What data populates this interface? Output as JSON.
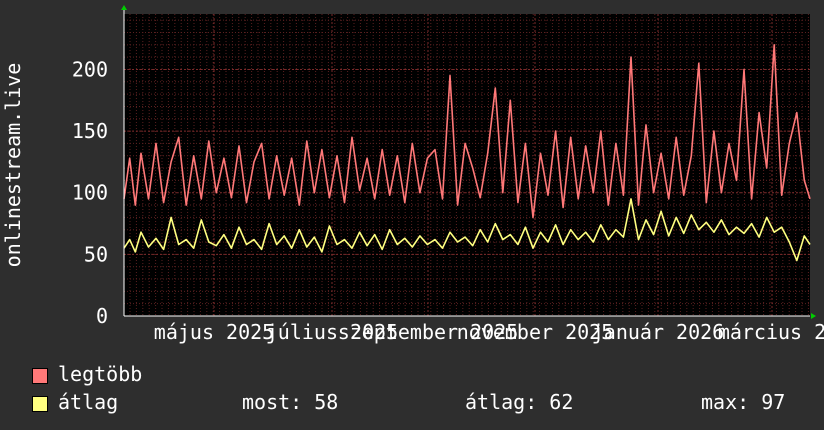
{
  "colors": {
    "background": "#2e2e2e",
    "plot_background": "#000000",
    "grid_minor": "#5a2020",
    "grid_major": "#7a2a2a",
    "axis": "#ffffff",
    "arrow": "#00cc00",
    "series_max": "#ff7878",
    "series_avg": "#ffff80"
  },
  "legend": {
    "max_label": "legtöbb",
    "avg_label": "átlag",
    "now_text": "most: 58",
    "avg_text": "átlag: 62",
    "max_text": "max: 97"
  },
  "chart_data": {
    "type": "line",
    "ylabel": "onlinestream.live",
    "ylim": [
      0,
      245
    ],
    "yticks": [
      0,
      50,
      100,
      150,
      200
    ],
    "xticks": [
      "május 2025",
      "július 2025",
      "szeptember 2025",
      "november 2025",
      "január 2026",
      "március 2"
    ],
    "x_range": [
      "2025-04-01",
      "2026-03-31"
    ],
    "grid": true,
    "series": [
      {
        "name": "legtöbb",
        "color": "#ff7878",
        "x": [
          "2025-04-01",
          "2025-04-04",
          "2025-04-07",
          "2025-04-10",
          "2025-04-14",
          "2025-04-18",
          "2025-04-22",
          "2025-04-26",
          "2025-04-30",
          "2025-05-04",
          "2025-05-08",
          "2025-05-12",
          "2025-05-16",
          "2025-05-20",
          "2025-05-24",
          "2025-05-28",
          "2025-06-01",
          "2025-06-05",
          "2025-06-09",
          "2025-06-13",
          "2025-06-17",
          "2025-06-21",
          "2025-06-25",
          "2025-06-29",
          "2025-07-03",
          "2025-07-07",
          "2025-07-11",
          "2025-07-15",
          "2025-07-19",
          "2025-07-23",
          "2025-07-27",
          "2025-07-31",
          "2025-08-04",
          "2025-08-08",
          "2025-08-12",
          "2025-08-16",
          "2025-08-20",
          "2025-08-24",
          "2025-08-28",
          "2025-09-01",
          "2025-09-05",
          "2025-09-09",
          "2025-09-13",
          "2025-09-17",
          "2025-09-21",
          "2025-09-25",
          "2025-09-29",
          "2025-10-03",
          "2025-10-07",
          "2025-10-11",
          "2025-10-15",
          "2025-10-19",
          "2025-10-23",
          "2025-10-27",
          "2025-10-31",
          "2025-11-04",
          "2025-11-08",
          "2025-11-12",
          "2025-11-16",
          "2025-11-20",
          "2025-11-24",
          "2025-11-28",
          "2025-12-02",
          "2025-12-06",
          "2025-12-10",
          "2025-12-14",
          "2025-12-18",
          "2025-12-22",
          "2025-12-26",
          "2025-12-30",
          "2026-01-03",
          "2026-01-07",
          "2026-01-11",
          "2026-01-15",
          "2026-01-19",
          "2026-01-23",
          "2026-01-27",
          "2026-01-31",
          "2026-02-04",
          "2026-02-08",
          "2026-02-12",
          "2026-02-16",
          "2026-02-20",
          "2026-02-24",
          "2026-02-28",
          "2026-03-04",
          "2026-03-08",
          "2026-03-12",
          "2026-03-16",
          "2026-03-20",
          "2026-03-24",
          "2026-03-28",
          "2026-03-31"
        ],
        "values": [
          95,
          128,
          90,
          132,
          95,
          140,
          92,
          125,
          145,
          90,
          130,
          95,
          142,
          100,
          128,
          96,
          138,
          92,
          125,
          140,
          95,
          130,
          98,
          128,
          90,
          142,
          100,
          135,
          96,
          130,
          92,
          145,
          102,
          128,
          95,
          135,
          98,
          130,
          92,
          140,
          100,
          128,
          135,
          95,
          195,
          90,
          140,
          120,
          96,
          132,
          185,
          100,
          175,
          92,
          140,
          80,
          132,
          98,
          150,
          88,
          145,
          95,
          138,
          100,
          150,
          90,
          140,
          98,
          210,
          90,
          155,
          100,
          132,
          95,
          145,
          98,
          130,
          205,
          92,
          150,
          100,
          140,
          110,
          200,
          95,
          165,
          120,
          220,
          98,
          140,
          165,
          110,
          95
        ]
      },
      {
        "name": "átlag",
        "color": "#ffff80",
        "x": [
          "2025-04-01",
          "2025-04-04",
          "2025-04-07",
          "2025-04-10",
          "2025-04-14",
          "2025-04-18",
          "2025-04-22",
          "2025-04-26",
          "2025-04-30",
          "2025-05-04",
          "2025-05-08",
          "2025-05-12",
          "2025-05-16",
          "2025-05-20",
          "2025-05-24",
          "2025-05-28",
          "2025-06-01",
          "2025-06-05",
          "2025-06-09",
          "2025-06-13",
          "2025-06-17",
          "2025-06-21",
          "2025-06-25",
          "2025-06-29",
          "2025-07-03",
          "2025-07-07",
          "2025-07-11",
          "2025-07-15",
          "2025-07-19",
          "2025-07-23",
          "2025-07-27",
          "2025-07-31",
          "2025-08-04",
          "2025-08-08",
          "2025-08-12",
          "2025-08-16",
          "2025-08-20",
          "2025-08-24",
          "2025-08-28",
          "2025-09-01",
          "2025-09-05",
          "2025-09-09",
          "2025-09-13",
          "2025-09-17",
          "2025-09-21",
          "2025-09-25",
          "2025-09-29",
          "2025-10-03",
          "2025-10-07",
          "2025-10-11",
          "2025-10-15",
          "2025-10-19",
          "2025-10-23",
          "2025-10-27",
          "2025-10-31",
          "2025-11-04",
          "2025-11-08",
          "2025-11-12",
          "2025-11-16",
          "2025-11-20",
          "2025-11-24",
          "2025-11-28",
          "2025-12-02",
          "2025-12-06",
          "2025-12-10",
          "2025-12-14",
          "2025-12-18",
          "2025-12-22",
          "2025-12-26",
          "2025-12-30",
          "2026-01-03",
          "2026-01-07",
          "2026-01-11",
          "2026-01-15",
          "2026-01-19",
          "2026-01-23",
          "2026-01-27",
          "2026-01-31",
          "2026-02-04",
          "2026-02-08",
          "2026-02-12",
          "2026-02-16",
          "2026-02-20",
          "2026-02-24",
          "2026-02-28",
          "2026-03-04",
          "2026-03-08",
          "2026-03-12",
          "2026-03-16",
          "2026-03-20",
          "2026-03-24",
          "2026-03-28",
          "2026-03-31"
        ],
        "values": [
          55,
          62,
          52,
          68,
          56,
          63,
          54,
          80,
          58,
          62,
          55,
          78,
          60,
          57,
          66,
          55,
          72,
          58,
          62,
          54,
          75,
          58,
          65,
          55,
          70,
          56,
          64,
          52,
          73,
          58,
          62,
          55,
          68,
          57,
          66,
          54,
          70,
          58,
          63,
          56,
          65,
          58,
          62,
          55,
          68,
          60,
          64,
          57,
          70,
          60,
          75,
          62,
          66,
          58,
          72,
          55,
          68,
          60,
          74,
          58,
          70,
          62,
          68,
          60,
          74,
          62,
          70,
          64,
          95,
          62,
          78,
          66,
          85,
          65,
          80,
          67,
          82,
          70,
          76,
          68,
          78,
          66,
          72,
          67,
          75,
          64,
          80,
          68,
          72,
          60,
          45,
          65,
          58
        ]
      }
    ]
  }
}
